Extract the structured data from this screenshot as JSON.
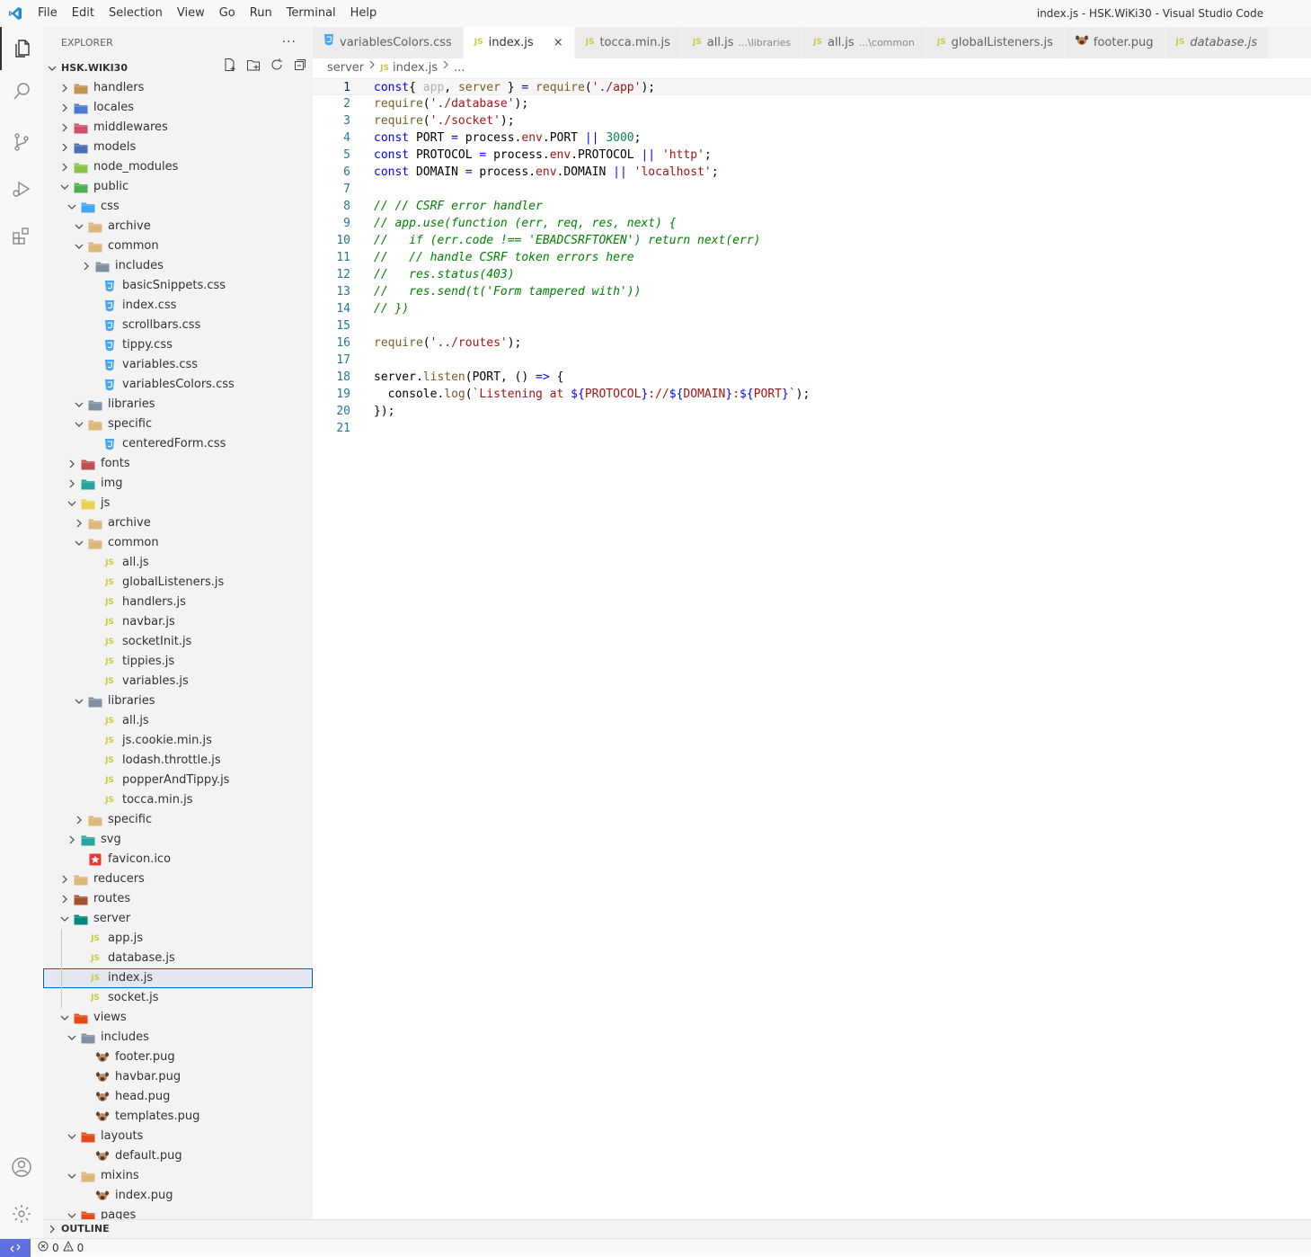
{
  "menu": [
    "File",
    "Edit",
    "Selection",
    "View",
    "Go",
    "Run",
    "Terminal",
    "Help"
  ],
  "window_title": "index.js - HSK.WiKi30 - Visual Studio Code",
  "explorer": {
    "title": "EXPLORER",
    "more": "···",
    "workspace": "HSK.WIKI30",
    "rows": [
      {
        "l": "handlers",
        "d": 0,
        "t": "folder",
        "o": false,
        "c": "#c09553"
      },
      {
        "l": "locales",
        "d": 0,
        "t": "folder",
        "o": false,
        "c": "#4a7bd0"
      },
      {
        "l": "middlewares",
        "d": 0,
        "t": "folder",
        "o": false,
        "c": "#d0506a"
      },
      {
        "l": "models",
        "d": 0,
        "t": "folder",
        "o": false,
        "c": "#4a6fb5"
      },
      {
        "l": "node_modules",
        "d": 0,
        "t": "folder",
        "o": false,
        "c": "#8bc34a"
      },
      {
        "l": "public",
        "d": 0,
        "t": "folder",
        "o": true,
        "c": "#4caf50"
      },
      {
        "l": "css",
        "d": 1,
        "t": "folder",
        "o": true,
        "c": "#42a5f5"
      },
      {
        "l": "archive",
        "d": 2,
        "t": "folder",
        "o": true,
        "c": "#dcb67a"
      },
      {
        "l": "common",
        "d": 2,
        "t": "folder",
        "o": true,
        "c": "#dcb67a"
      },
      {
        "l": "includes",
        "d": 3,
        "t": "folder",
        "o": false,
        "c": "#8090a0"
      },
      {
        "l": "basicSnippets.css",
        "d": 3,
        "t": "css"
      },
      {
        "l": "index.css",
        "d": 3,
        "t": "css"
      },
      {
        "l": "scrollbars.css",
        "d": 3,
        "t": "css"
      },
      {
        "l": "tippy.css",
        "d": 3,
        "t": "css"
      },
      {
        "l": "variables.css",
        "d": 3,
        "t": "css"
      },
      {
        "l": "variablesColors.css",
        "d": 3,
        "t": "css"
      },
      {
        "l": "libraries",
        "d": 2,
        "t": "folder",
        "o": true,
        "c": "#8090a0"
      },
      {
        "l": "specific",
        "d": 2,
        "t": "folder",
        "o": true,
        "c": "#dcb67a"
      },
      {
        "l": "centeredForm.css",
        "d": 3,
        "t": "css"
      },
      {
        "l": "fonts",
        "d": 1,
        "t": "folder",
        "o": false,
        "c": "#c0504d"
      },
      {
        "l": "img",
        "d": 1,
        "t": "folder",
        "o": false,
        "c": "#26a69a"
      },
      {
        "l": "js",
        "d": 1,
        "t": "folder",
        "o": true,
        "c": "#e6d34f"
      },
      {
        "l": "archive",
        "d": 2,
        "t": "folder",
        "o": false,
        "c": "#dcb67a"
      },
      {
        "l": "common",
        "d": 2,
        "t": "folder",
        "o": true,
        "c": "#dcb67a"
      },
      {
        "l": "all.js",
        "d": 3,
        "t": "js"
      },
      {
        "l": "globalListeners.js",
        "d": 3,
        "t": "js"
      },
      {
        "l": "handlers.js",
        "d": 3,
        "t": "js"
      },
      {
        "l": "navbar.js",
        "d": 3,
        "t": "js"
      },
      {
        "l": "socketInit.js",
        "d": 3,
        "t": "js"
      },
      {
        "l": "tippies.js",
        "d": 3,
        "t": "js"
      },
      {
        "l": "variables.js",
        "d": 3,
        "t": "js"
      },
      {
        "l": "libraries",
        "d": 2,
        "t": "folder",
        "o": true,
        "c": "#8090a0"
      },
      {
        "l": "all.js",
        "d": 3,
        "t": "js"
      },
      {
        "l": "js.cookie.min.js",
        "d": 3,
        "t": "js"
      },
      {
        "l": "lodash.throttle.js",
        "d": 3,
        "t": "js"
      },
      {
        "l": "popperAndTippy.js",
        "d": 3,
        "t": "js"
      },
      {
        "l": "tocca.min.js",
        "d": 3,
        "t": "js"
      },
      {
        "l": "specific",
        "d": 2,
        "t": "folder",
        "o": false,
        "c": "#dcb67a"
      },
      {
        "l": "svg",
        "d": 1,
        "t": "folder",
        "o": false,
        "c": "#26a69a"
      },
      {
        "l": "favicon.ico",
        "d": 1,
        "t": "ico"
      },
      {
        "l": "reducers",
        "d": 0,
        "t": "folder",
        "o": false,
        "c": "#dcb67a"
      },
      {
        "l": "routes",
        "d": 0,
        "t": "folder",
        "o": false,
        "c": "#a0522d"
      },
      {
        "l": "server",
        "d": 0,
        "t": "folder",
        "o": true,
        "c": "#00897b"
      },
      {
        "l": "app.js",
        "d": 1,
        "t": "js"
      },
      {
        "l": "database.js",
        "d": 1,
        "t": "js"
      },
      {
        "l": "index.js",
        "d": 1,
        "t": "js",
        "sel": true
      },
      {
        "l": "socket.js",
        "d": 1,
        "t": "js"
      },
      {
        "l": "views",
        "d": 0,
        "t": "folder",
        "o": true,
        "c": "#e64a19"
      },
      {
        "l": "includes",
        "d": 1,
        "t": "folder",
        "o": true,
        "c": "#8090a0"
      },
      {
        "l": "footer.pug",
        "d": 2,
        "t": "pug"
      },
      {
        "l": "havbar.pug",
        "d": 2,
        "t": "pug"
      },
      {
        "l": "head.pug",
        "d": 2,
        "t": "pug"
      },
      {
        "l": "templates.pug",
        "d": 2,
        "t": "pug"
      },
      {
        "l": "layouts",
        "d": 1,
        "t": "folder",
        "o": true,
        "c": "#e64a19"
      },
      {
        "l": "default.pug",
        "d": 2,
        "t": "pug"
      },
      {
        "l": "mixins",
        "d": 1,
        "t": "folder",
        "o": true,
        "c": "#dcb67a"
      },
      {
        "l": "index.pug",
        "d": 2,
        "t": "pug"
      },
      {
        "l": "pages",
        "d": 1,
        "t": "folder",
        "o": true,
        "c": "#e64a19"
      }
    ]
  },
  "outline": "OUTLINE",
  "tabs": [
    {
      "l": "variablesColors.css",
      "t": "css",
      "desc": ""
    },
    {
      "l": "index.js",
      "t": "js",
      "desc": "",
      "active": true
    },
    {
      "l": "tocca.min.js",
      "t": "js",
      "desc": ""
    },
    {
      "l": "all.js",
      "t": "js",
      "desc": "...\\libraries"
    },
    {
      "l": "all.js",
      "t": "js",
      "desc": "...\\common"
    },
    {
      "l": "globalListeners.js",
      "t": "js",
      "desc": ""
    },
    {
      "l": "footer.pug",
      "t": "pug",
      "desc": ""
    },
    {
      "l": "database.js",
      "t": "js",
      "desc": "",
      "italic": true
    }
  ],
  "tab_close": "×",
  "breadcrumb": {
    "folder": "server",
    "file": "index.js",
    "more": "..."
  },
  "code": [
    [
      [
        "k",
        "const"
      ],
      [
        "",
        "{ "
      ],
      [
        "dim",
        "app"
      ],
      [
        "",
        ", "
      ],
      [
        "f",
        "server"
      ],
      [
        "",
        " } "
      ],
      [
        "k",
        "="
      ],
      [
        "",
        " "
      ],
      [
        "f",
        "require"
      ],
      [
        "",
        "("
      ],
      [
        "s",
        "'./app'"
      ],
      [
        "",
        ");"
      ]
    ],
    [
      [
        "f",
        "require"
      ],
      [
        "",
        "("
      ],
      [
        "s",
        "'./database'"
      ],
      [
        "",
        ");"
      ]
    ],
    [
      [
        "f",
        "require"
      ],
      [
        "",
        "("
      ],
      [
        "s",
        "'./socket'"
      ],
      [
        "",
        ");"
      ]
    ],
    [
      [
        "k",
        "const"
      ],
      [
        "",
        " PORT "
      ],
      [
        "k",
        "="
      ],
      [
        "",
        " process."
      ],
      [
        "s",
        "env"
      ],
      [
        "",
        ".PORT "
      ],
      [
        "k",
        "||"
      ],
      [
        "",
        " "
      ],
      [
        "n",
        "3000"
      ],
      [
        "",
        ";"
      ]
    ],
    [
      [
        "k",
        "const"
      ],
      [
        "",
        " PROTOCOL "
      ],
      [
        "k",
        "="
      ],
      [
        "",
        " process."
      ],
      [
        "s",
        "env"
      ],
      [
        "",
        ".PROTOCOL "
      ],
      [
        "k",
        "||"
      ],
      [
        "",
        " "
      ],
      [
        "s",
        "'http'"
      ],
      [
        "",
        ";"
      ]
    ],
    [
      [
        "k",
        "const"
      ],
      [
        "",
        " DOMAIN "
      ],
      [
        "k",
        "="
      ],
      [
        "",
        " process."
      ],
      [
        "s",
        "env"
      ],
      [
        "",
        ".DOMAIN "
      ],
      [
        "k",
        "||"
      ],
      [
        "",
        " "
      ],
      [
        "s",
        "'localhost'"
      ],
      [
        "",
        ";"
      ]
    ],
    [],
    [
      [
        "c",
        "// // CSRF error handler"
      ]
    ],
    [
      [
        "c",
        "// app.use(function (err, req, res, next) {"
      ]
    ],
    [
      [
        "c",
        "//   if (err.code !== 'EBADCSRFTOKEN') return next(err)"
      ]
    ],
    [
      [
        "c",
        "//   // handle CSRF token errors here"
      ]
    ],
    [
      [
        "c",
        "//   res.status(403)"
      ]
    ],
    [
      [
        "c",
        "//   res.send(t('Form tampered with'))"
      ]
    ],
    [
      [
        "c",
        "// })"
      ]
    ],
    [],
    [
      [
        "f",
        "require"
      ],
      [
        "",
        "("
      ],
      [
        "s",
        "'../routes'"
      ],
      [
        "",
        ");"
      ]
    ],
    [],
    [
      [
        "",
        "server."
      ],
      [
        "f",
        "listen"
      ],
      [
        "",
        "(PORT, () "
      ],
      [
        "k",
        "=>"
      ],
      [
        "",
        " {"
      ]
    ],
    [
      [
        "",
        "  console."
      ],
      [
        "f",
        "log"
      ],
      [
        "",
        "("
      ],
      [
        "s",
        "`Listening at "
      ],
      [
        "k",
        "${"
      ],
      [
        "s",
        "PROTOCOL"
      ],
      [
        "k",
        "}"
      ],
      [
        "s",
        "://"
      ],
      [
        "k",
        "${"
      ],
      [
        "s",
        "DOMAIN"
      ],
      [
        "k",
        "}"
      ],
      [
        "s",
        ":"
      ],
      [
        "k",
        "${"
      ],
      [
        "s",
        "PORT"
      ],
      [
        "k",
        "}"
      ],
      [
        "s",
        "`"
      ],
      [
        "",
        ");"
      ]
    ],
    [
      [
        "",
        "});"
      ]
    ],
    []
  ],
  "status": {
    "errors": "0",
    "warnings": "0"
  }
}
